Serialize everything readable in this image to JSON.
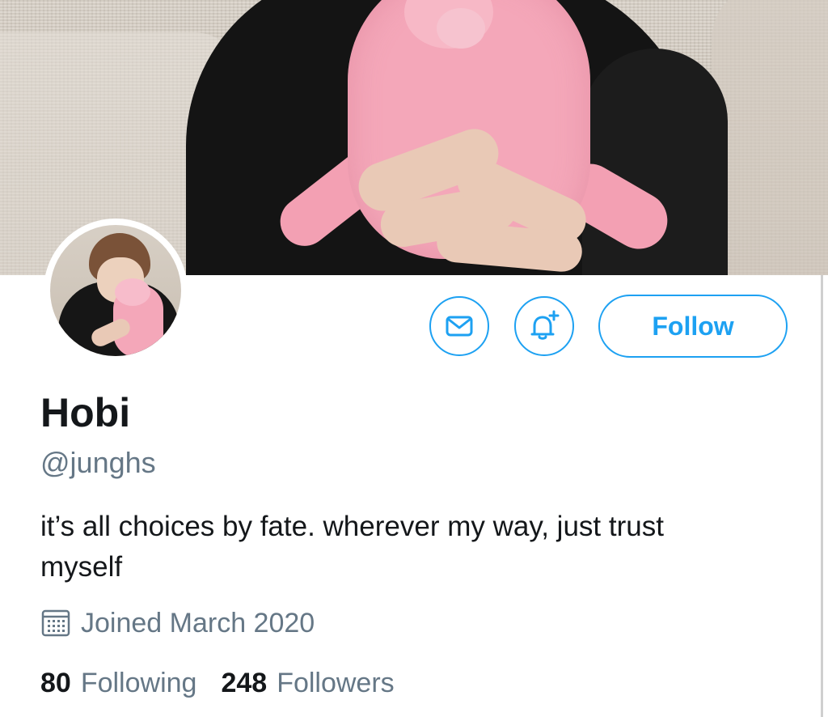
{
  "profile": {
    "display_name": "Hobi",
    "handle": "@junghs",
    "bio": "it’s all choices by fate. wherever my way, just trust myself",
    "joined": "Joined March 2020",
    "following_count": "80",
    "following_label": "Following",
    "followers_count": "248",
    "followers_label": "Followers"
  },
  "actions": {
    "follow_label": "Follow",
    "message_icon": "envelope-icon",
    "notify_icon": "bell-plus-icon"
  },
  "icons": {
    "joined": "calendar-icon"
  },
  "colors": {
    "accent": "#1da1f2",
    "text_primary": "#14171a",
    "text_secondary": "#657786",
    "background": "#ffffff"
  }
}
